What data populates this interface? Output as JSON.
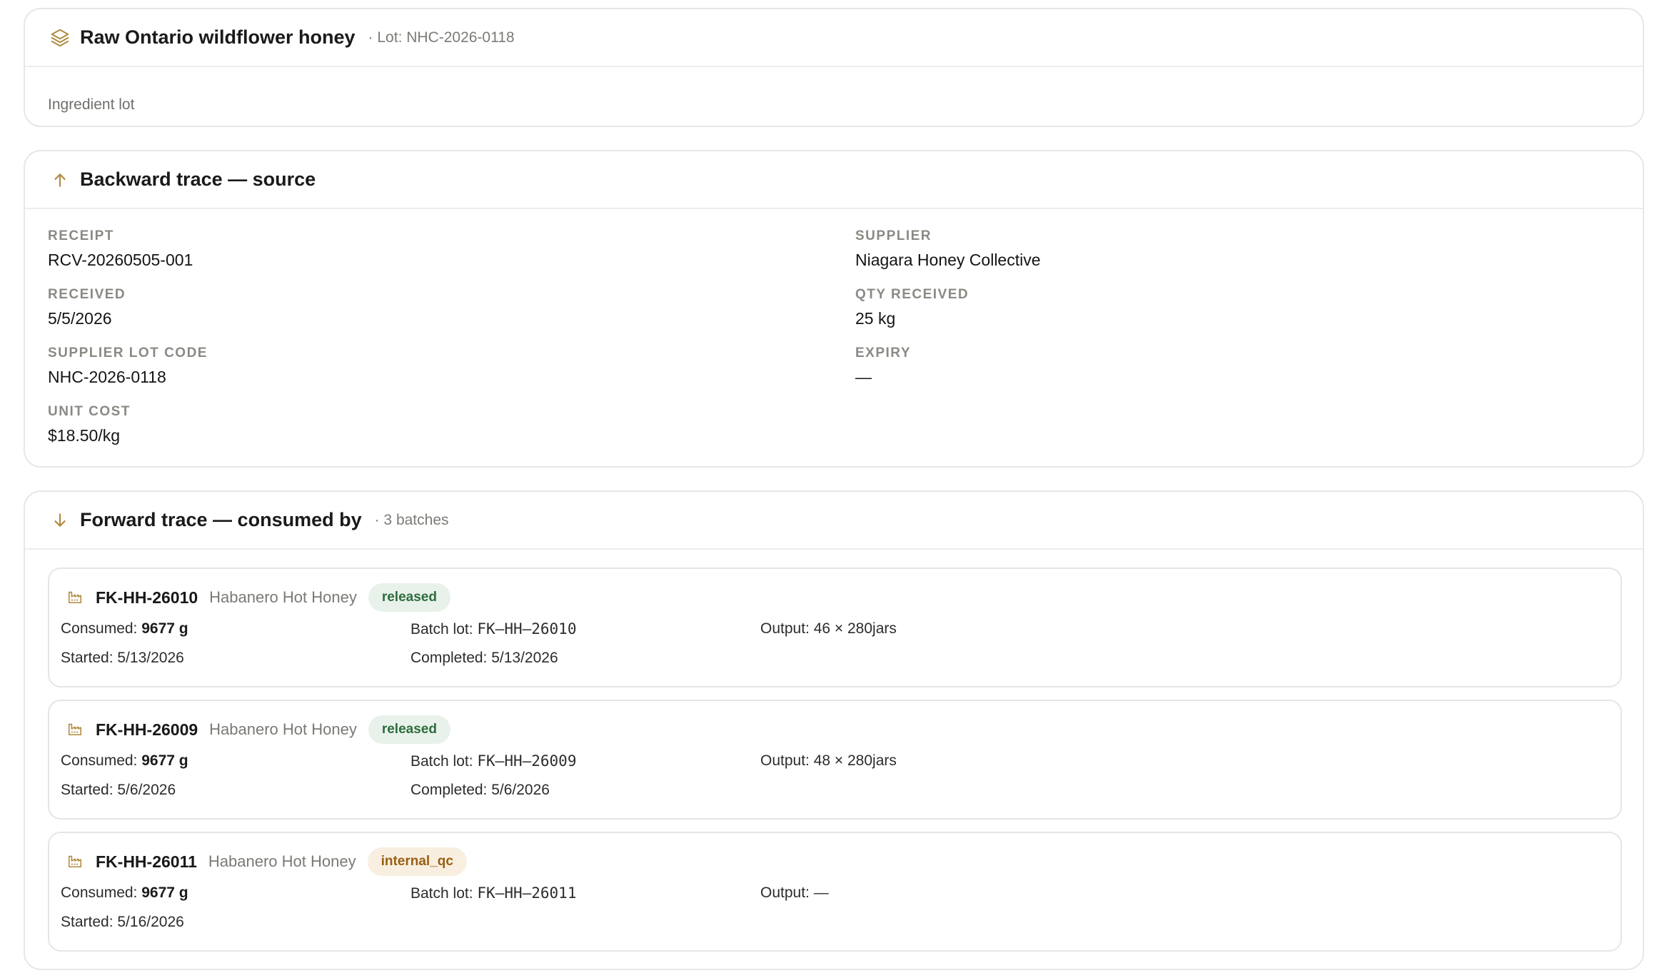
{
  "ingredient": {
    "title": "Raw Ontario wildflower honey",
    "lot_meta": "· Lot: NHC-2026-0118",
    "type": "Ingredient lot",
    "icon": "layers-icon"
  },
  "backward_trace": {
    "title": "Backward trace — source",
    "icon": "arrow-up-icon",
    "fields": {
      "receipt": {
        "label": "RECEIPT",
        "value": "RCV-20260505-001"
      },
      "supplier": {
        "label": "SUPPLIER",
        "value": "Niagara Honey Collective"
      },
      "received": {
        "label": "RECEIVED",
        "value": "5/5/2026"
      },
      "qty_received": {
        "label": "QTY RECEIVED",
        "value": "25 kg"
      },
      "supplier_lot_code": {
        "label": "SUPPLIER LOT CODE",
        "value": "NHC-2026-0118"
      },
      "expiry": {
        "label": "EXPIRY",
        "value": "—"
      },
      "unit_cost": {
        "label": "UNIT COST",
        "value": "$18.50/kg"
      }
    }
  },
  "forward_trace": {
    "title": "Forward trace — consumed by",
    "meta": "· 3 batches",
    "icon": "arrow-down-icon",
    "batches": [
      {
        "code": "FK-HH-26010",
        "product": "Habanero Hot Honey",
        "status": "released",
        "consumed_label": "Consumed: ",
        "consumed_value": "9677 g",
        "batch_lot_label": "Batch lot: ",
        "batch_lot_value": "FK–HH–26010",
        "output": "Output: 46 × 280jars",
        "started": "Started: 5/13/2026",
        "completed": "Completed: 5/13/2026"
      },
      {
        "code": "FK-HH-26009",
        "product": "Habanero Hot Honey",
        "status": "released",
        "consumed_label": "Consumed: ",
        "consumed_value": "9677 g",
        "batch_lot_label": "Batch lot: ",
        "batch_lot_value": "FK–HH–26009",
        "output": "Output: 48 × 280jars",
        "started": "Started: 5/6/2026",
        "completed": "Completed: 5/6/2026"
      },
      {
        "code": "FK-HH-26011",
        "product": "Habanero Hot Honey",
        "status": "internal_qc",
        "consumed_label": "Consumed: ",
        "consumed_value": "9677 g",
        "batch_lot_label": "Batch lot: ",
        "batch_lot_value": "FK–HH–26011",
        "output": "Output: —",
        "started": "Started: 5/16/2026"
      }
    ]
  },
  "colors": {
    "accent": "#b08a3e",
    "released_bg": "#e8f1ea",
    "released_text": "#2e6d3e",
    "qc_bg": "#f8efe1",
    "qc_text": "#9a5f12"
  }
}
